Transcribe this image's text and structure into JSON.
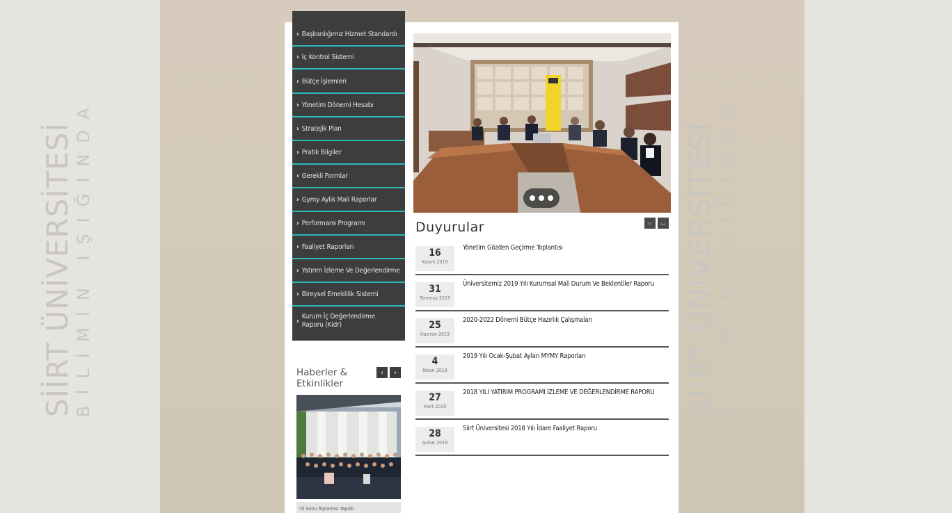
{
  "watermark": {
    "line1": "SİİRT ÜNİVERSİTESİ",
    "line2": "BİLİMİN IŞIĞINDA"
  },
  "menu": {
    "items": [
      {
        "label": "Başkanlığımız Hizmet Standardı"
      },
      {
        "label": "İç Kontrol Sistemi"
      },
      {
        "label": "Bütçe İşlemleri"
      },
      {
        "label": "Yönetim Dönemi Hesabı"
      },
      {
        "label": "Stratejik Plan"
      },
      {
        "label": "Pratik Bilgiler"
      },
      {
        "label": "Gerekli Formlar"
      },
      {
        "label": "Gymy Aylık Mali Raporlar"
      },
      {
        "label": "Performans Programı"
      },
      {
        "label": "Faaliyet Raporları"
      },
      {
        "label": "Yatırım İzleme Ve Değerlendirme"
      },
      {
        "label": "Bireysel Emeklilik Sistemi"
      },
      {
        "label": "Kurum İç Değerlendirme Raporu (Kidr)"
      }
    ]
  },
  "announcements": {
    "title": "Duyurular",
    "items": [
      {
        "day": "16",
        "month": "Kasım 2019",
        "text": "Yönetim Gözden Geçirme Toplantısı"
      },
      {
        "day": "31",
        "month": "Temmuz 2019",
        "text": "Üniversitemiz 2019 Yılı Kurumsal Mali Durum Ve Beklentiler Raporu"
      },
      {
        "day": "25",
        "month": "Haziran 2019",
        "text": "2020-2022 Dönemi Bütçe Hazırlık Çalışmaları"
      },
      {
        "day": "4",
        "month": "Nisan 2019",
        "text": "2019 Yılı Ocak-Şubat Ayları MYMY Raporları"
      },
      {
        "day": "27",
        "month": "Mart 2019",
        "text": "2018 YILI YATIRIM PROGRAMI İZLEME VE DEĞERLENDİRME RAPORU"
      },
      {
        "day": "28",
        "month": "Şubat 2019",
        "text": "Siirt Üniversitesi 2018 Yılı İdare Faaliyet Raporu"
      }
    ]
  },
  "news": {
    "title": "Haberler & Etkinlikler",
    "caption": "Yıl Sonu Toplantısı Yapıldı"
  },
  "icons": {
    "menu_chevron": "chevron-right-icon",
    "prev": "chevron-left-icon",
    "next": "chevron-right-icon",
    "down": "chevron-down-icon",
    "up": "chevron-up-icon"
  },
  "colors": {
    "menu_bg": "#3d3d3d",
    "menu_divider": "#2fb8b8",
    "panel_bg": "#ffffff"
  }
}
